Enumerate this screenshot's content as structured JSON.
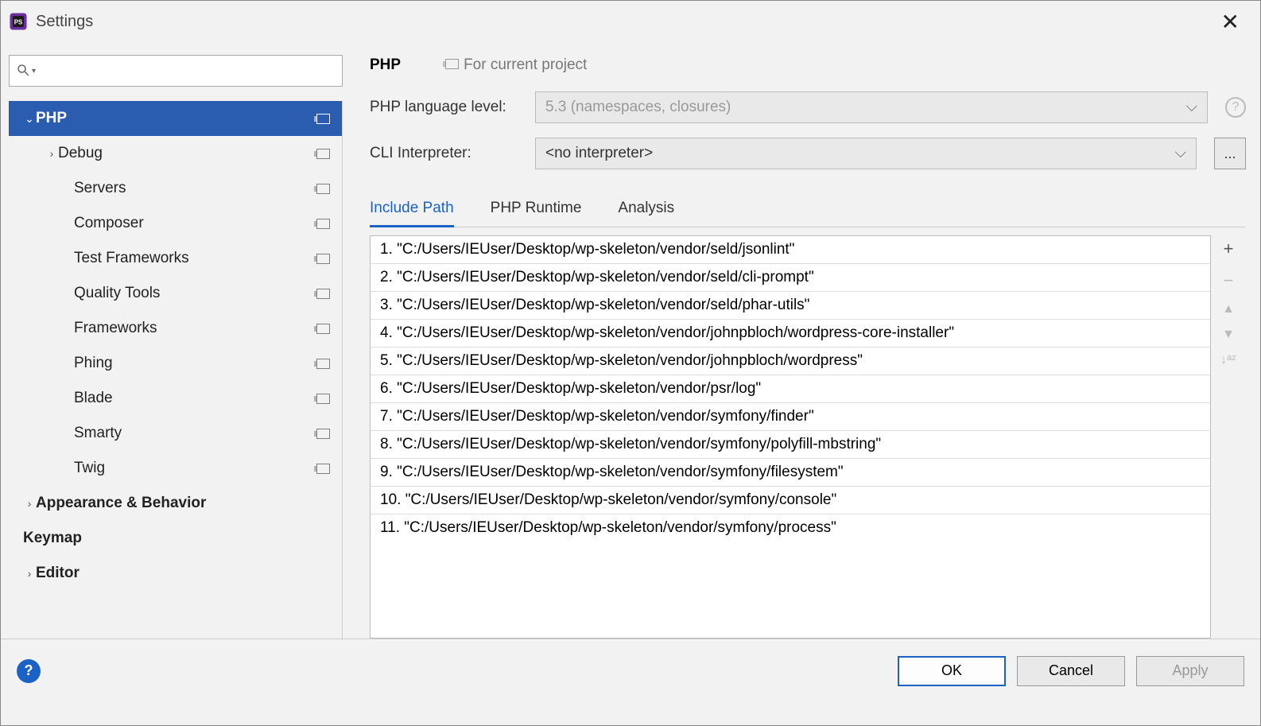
{
  "window": {
    "title": "Settings"
  },
  "search": {
    "value": ""
  },
  "tree": [
    {
      "label": "PHP",
      "level": 0,
      "arrow": "down",
      "selected": true,
      "bold": true,
      "proj": true
    },
    {
      "label": "Debug",
      "level": 1,
      "arrow": "right",
      "proj": true
    },
    {
      "label": "Servers",
      "level": 2,
      "noarrow": true,
      "proj": true
    },
    {
      "label": "Composer",
      "level": 2,
      "noarrow": true,
      "proj": true
    },
    {
      "label": "Test Frameworks",
      "level": 2,
      "noarrow": true,
      "proj": true
    },
    {
      "label": "Quality Tools",
      "level": 2,
      "noarrow": true,
      "proj": true
    },
    {
      "label": "Frameworks",
      "level": 2,
      "noarrow": true,
      "proj": true
    },
    {
      "label": "Phing",
      "level": 2,
      "noarrow": true,
      "proj": true
    },
    {
      "label": "Blade",
      "level": 2,
      "noarrow": true,
      "proj": true
    },
    {
      "label": "Smarty",
      "level": 2,
      "noarrow": true,
      "proj": true
    },
    {
      "label": "Twig",
      "level": 2,
      "noarrow": true,
      "proj": true
    },
    {
      "label": "Appearance & Behavior",
      "level": 0,
      "arrow": "right",
      "bold": true
    },
    {
      "label": "Keymap",
      "level": 0,
      "noarrow": true,
      "bold": true
    },
    {
      "label": "Editor",
      "level": 0,
      "arrow": "right",
      "bold": true
    }
  ],
  "header": {
    "title": "PHP",
    "hint": "For current project"
  },
  "form": {
    "langlevel_label": "PHP language level:",
    "langlevel_value": "5.3 (namespaces, closures)",
    "cli_label": "CLI Interpreter:",
    "cli_value": "<no interpreter>",
    "ellipsis": "..."
  },
  "tabs": [
    {
      "label": "Include Path",
      "active": true
    },
    {
      "label": "PHP Runtime",
      "active": false
    },
    {
      "label": "Analysis",
      "active": false
    }
  ],
  "paths": [
    "1. \"C:/Users/IEUser/Desktop/wp-skeleton/vendor/seld/jsonlint\"",
    "2. \"C:/Users/IEUser/Desktop/wp-skeleton/vendor/seld/cli-prompt\"",
    "3. \"C:/Users/IEUser/Desktop/wp-skeleton/vendor/seld/phar-utils\"",
    "4. \"C:/Users/IEUser/Desktop/wp-skeleton/vendor/johnpbloch/wordpress-core-installer\"",
    "5. \"C:/Users/IEUser/Desktop/wp-skeleton/vendor/johnpbloch/wordpress\"",
    "6. \"C:/Users/IEUser/Desktop/wp-skeleton/vendor/psr/log\"",
    "7. \"C:/Users/IEUser/Desktop/wp-skeleton/vendor/symfony/finder\"",
    "8. \"C:/Users/IEUser/Desktop/wp-skeleton/vendor/symfony/polyfill-mbstring\"",
    "9. \"C:/Users/IEUser/Desktop/wp-skeleton/vendor/symfony/filesystem\"",
    "10. \"C:/Users/IEUser/Desktop/wp-skeleton/vendor/symfony/console\"",
    "11. \"C:/Users/IEUser/Desktop/wp-skeleton/vendor/symfony/process\""
  ],
  "tools": {
    "add": "+",
    "remove": "−",
    "up": "▲",
    "down": "▼",
    "sort": "↓ᵃᶻ"
  },
  "footer": {
    "ok": "OK",
    "cancel": "Cancel",
    "apply": "Apply"
  }
}
